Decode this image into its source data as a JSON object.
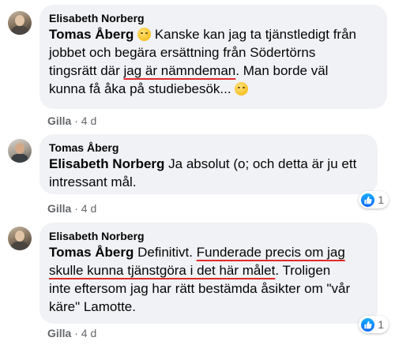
{
  "comments": [
    {
      "author": "Elisabeth Norberg",
      "mention": "Tomas Åberg",
      "line1_rest": " Kanske kan jag ta tjänstledigt från",
      "line2": "jobbet och begära ersättning från Södertörns",
      "line3_pre": "tingsrätt där ",
      "line3_ul": "jag är nämndeman",
      "line3_post": ". Man borde väl",
      "line4": "kunna få åka på studiebesök...",
      "emoji_1": "smiling-face-icon",
      "emoji_2": "thinking-face-icon",
      "like_label": "Gilla",
      "time": " · 4 d"
    },
    {
      "author": "Tomas Åberg",
      "mention": "Elisabeth Norberg",
      "line1_rest": " Ja absolut (o; och detta är ju ett",
      "line2": "intressant mål.",
      "like_label": "Gilla",
      "time": " · 4 d",
      "reaction_count": "1",
      "reaction_icon": "thumbs-up-icon"
    },
    {
      "author": "Elisabeth Norberg",
      "mention": "Tomas Åberg",
      "line1_pre": " Definitivt. ",
      "line1_ul": "Funderade precis om jag",
      "line2_ul": "skulle kunna tjänstgöra i det här målet",
      "line2_post": ". Troligen",
      "line3": "inte eftersom jag har rätt bestämda åsikter om \"vår",
      "line4": "käre\" Lamotte.",
      "like_label": "Gilla",
      "time": " · 4 d",
      "reaction_count": "1",
      "reaction_icon": "thumbs-up-icon"
    }
  ],
  "colors": {
    "bubble": "#f0f2f5",
    "underline": "#e02a2a",
    "like": "#0866ff",
    "meta": "#65676b"
  }
}
